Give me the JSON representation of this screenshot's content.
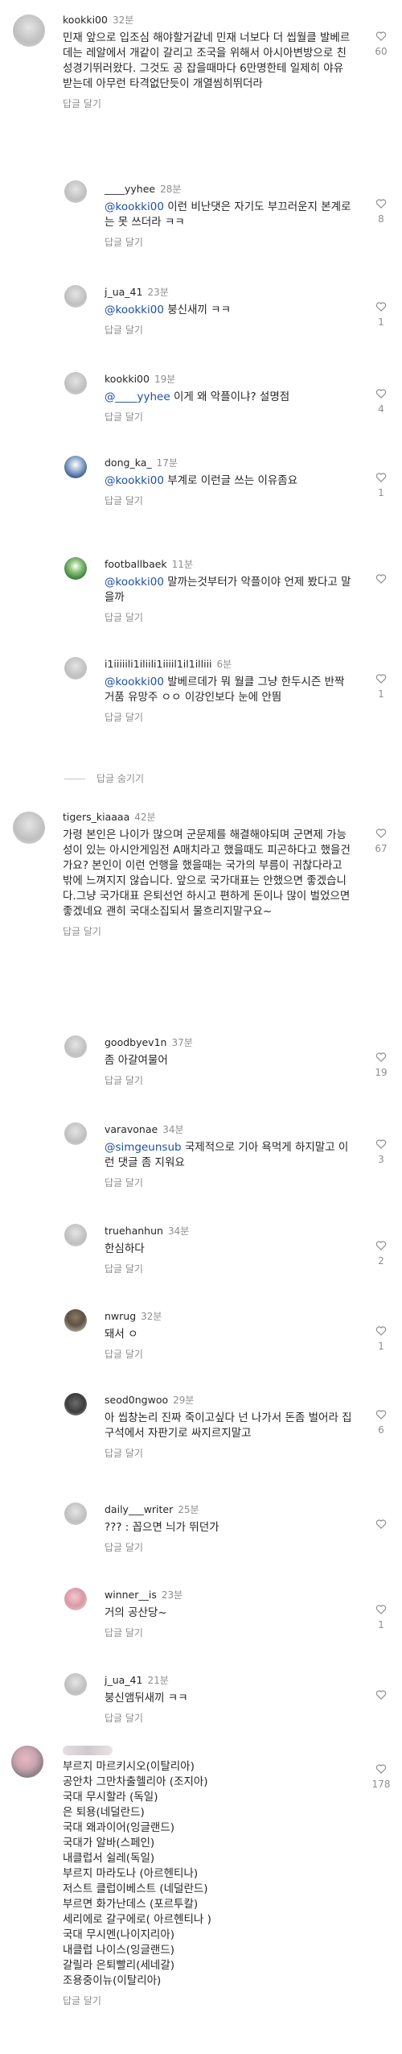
{
  "comments": [
    {
      "user": "kookki00",
      "time": "32분",
      "text": "민재 앞으로 입조심 해야할거같네 민재 너보다 더 씹월클 발베르데는 레알에서 개같이 갈리고 조국을 위해서 아시아변방으로 친성경기뛰러왔다. 그것도 공 잡을때마다 6만명한테 일제히 야유받는데 아무런 타격없단듯이 개열씸히뛰더라",
      "reply": "답글 달기",
      "likes": "60"
    },
    {
      "user": "____yyhee",
      "time": "28분",
      "mention": "@kookki00",
      "text": " 이런 비난댓은 자기도 부끄러운지 본계로는 못 쓰더라 ㅋㅋ",
      "reply": "답글 달기",
      "likes": "8"
    },
    {
      "user": "j_ua_41",
      "time": "23분",
      "mention": "@kookki00",
      "text": " 붕신새끼 ㅋㅋ",
      "reply": "답글 달기",
      "likes": "1"
    },
    {
      "user": "kookki00",
      "time": "19분",
      "mention": "@____yyhee",
      "text": " 이게 왜 악플이냐? 설명점",
      "reply": "답글 달기",
      "likes": "4"
    },
    {
      "user": "dong_ka_",
      "time": "17분",
      "mention": "@kookki00",
      "text": " 부계로 이런글 쓰는 이유좀요",
      "reply": "답글 달기",
      "likes": "1"
    },
    {
      "user": "footballbaek",
      "time": "11분",
      "mention": "@kookki00",
      "text": " 말까는것부터가 악플이야 언제 봤다고 말을까",
      "reply": "답글 달기",
      "likes": ""
    },
    {
      "user": "i1iiiiili1iliili1iiiil1il1illiii",
      "time": "6분",
      "mention": "@kookki00",
      "text": " 발베르데가 뭐 월클 그냥 한두시즌 반짝 거품 유망주 ㅇㅇ 이강인보다 눈에 안띔",
      "reply": "답글 달기",
      "likes": "1"
    },
    {
      "user": "tigers_kiaaaa",
      "time": "42분",
      "text": "가령 본인은 나이가 많으며 군문제를 해결해야되며 군면제 가능성이 있는 아시안게임전 A매치라고 했을때도 피곤하다고 했을건가요? 본인이 이런 언행을 했을때는 국가의 부름이 귀찮다라고 밖에 느껴지지 않습니다. 앞으로 국가대표는 안했으면 좋겠습니다.그냥 국가대표 은퇴선언 하시고 편하게 돈이나 많이 벌었으면 좋겠네요 괜히 국대소집되서 물흐리지말구요~",
      "reply": "답글 달기",
      "likes": "67"
    },
    {
      "user": "goodbyev1n",
      "time": "37분",
      "text": "좀 아갈여물어",
      "reply": "답글 달기",
      "likes": "19"
    },
    {
      "user": "varavonae",
      "time": "34분",
      "mention": "@simgeunsub",
      "text": " 국제적으로 기아 욕먹게 하지말고 이런 댓글 좀 지워요",
      "reply": "답글 달기",
      "likes": "3"
    },
    {
      "user": "truehanhun",
      "time": "34분",
      "text": "한심하다",
      "reply": "답글 달기",
      "likes": "2"
    },
    {
      "user": "nwrug",
      "time": "32분",
      "text": "돼서 ㅇ",
      "reply": "답글 달기",
      "likes": "1"
    },
    {
      "user": "seod0ngwoo",
      "time": "29분",
      "text": "아 씹창논리 진짜 죽이고싶다 넌 나가서 돈좀 벌어라 집구석에서 자판기로 싸지르지말고",
      "reply": "답글 달기",
      "likes": "6"
    },
    {
      "user": "daily___writer",
      "time": "25분",
      "text": "??? : 꼽으면 늬가 뛰던가",
      "reply": "답글 달기",
      "likes": ""
    },
    {
      "user": "winner__is",
      "time": "23분",
      "text": "거의 공산당~",
      "reply": "답글 달기",
      "likes": "1"
    },
    {
      "user": "j_ua_41",
      "time": "21분",
      "text": "붕신앰뒤새끼 ㅋㅋ",
      "reply": "답글 달기",
      "likes": ""
    },
    {
      "user": "",
      "time": "",
      "text": "부르지 마르키시오(이탈리아)\n공안차 그만차출헬리아 (조지아)\n국대 무시할라 (독일)\n은 퇴용(네덜란드)\n국대 왜과이어(잉글랜드)\n국대가 알바(스페인)\n내클럽서 쉴레(독일)\n부르지 마라도나 (아르헨티나)\n저스트 클럽이베스트 (네덜란드)\n부르면 화가난데스 (포르투칼)\n세리에로 갈구에로( 아르헨티나 )\n국대 무시멘(나이지리아)\n내클럽 나이스(잉글랜드)\n갈릴라 은퇴빨리(세네갈)\n조용중이뉴(이탈리아)",
      "reply": "답글 달기",
      "likes": "178"
    }
  ],
  "hide_replies_label": "답글 숨기기",
  "icons": {
    "heart": "heart-outline-icon",
    "avatar": "avatar-icon"
  }
}
